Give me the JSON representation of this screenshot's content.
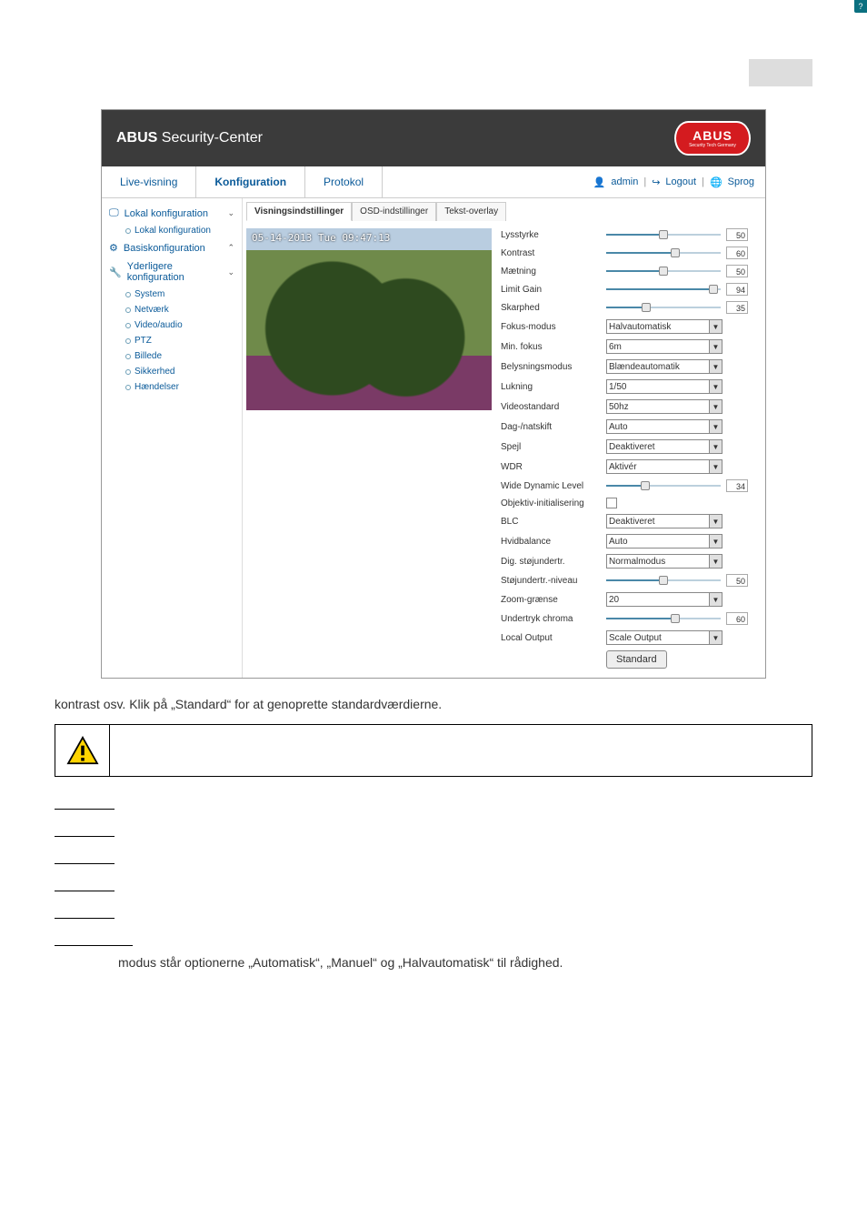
{
  "page_number_box": "",
  "brand_bold": "ABUS",
  "brand_rest": " Security-Center",
  "help_icon": "?",
  "logo_text": "ABUS",
  "logo_sub": "Security Tech Germany",
  "nav": {
    "live": "Live-visning",
    "config": "Konfiguration",
    "protocol": "Protokol"
  },
  "userbar": {
    "user": "admin",
    "logout": "Logout",
    "lang": "Sprog"
  },
  "sidebar": {
    "lokal_hdr": "Lokal konfiguration",
    "lokal_sub": "Lokal konfiguration",
    "basis_hdr": "Basiskonfiguration",
    "yderl_hdr": "Yderligere konfiguration",
    "items": {
      "system": "System",
      "netvaerk": "Netværk",
      "video": "Video/audio",
      "ptz": "PTZ",
      "billede": "Billede",
      "sikkerhed": "Sikkerhed",
      "haendelser": "Hændelser"
    }
  },
  "subtabs": {
    "disp": "Visningsindstillinger",
    "osd": "OSD-indstillinger",
    "text": "Tekst-overlay"
  },
  "preview_osd": "05-14-2013 Tue 09:47:13",
  "settings": {
    "lysstyrke": {
      "label": "Lysstyrke",
      "value": "50"
    },
    "kontrast": {
      "label": "Kontrast",
      "value": "60"
    },
    "maetning": {
      "label": "Mætning",
      "value": "50"
    },
    "limitgain": {
      "label": "Limit Gain",
      "value": "94"
    },
    "skarphed": {
      "label": "Skarphed",
      "value": "35"
    },
    "fokusmodus": {
      "label": "Fokus-modus",
      "value": "Halvautomatisk"
    },
    "minfokus": {
      "label": "Min. fokus",
      "value": "6m"
    },
    "belysning": {
      "label": "Belysningsmodus",
      "value": "Blændeautomatik"
    },
    "lukning": {
      "label": "Lukning",
      "value": "1/50"
    },
    "videostd": {
      "label": "Videostandard",
      "value": "50hz"
    },
    "dagnat": {
      "label": "Dag-/natskift",
      "value": "Auto"
    },
    "spejl": {
      "label": "Spejl",
      "value": "Deaktiveret"
    },
    "wdr": {
      "label": "WDR",
      "value": "Aktivér"
    },
    "wdl": {
      "label": "Wide Dynamic Level",
      "value": "34"
    },
    "objinit": {
      "label": "Objektiv-initialisering"
    },
    "blc": {
      "label": "BLC",
      "value": "Deaktiveret"
    },
    "hvid": {
      "label": "Hvidbalance",
      "value": "Auto"
    },
    "digstoj": {
      "label": "Dig. støjundertr.",
      "value": "Normalmodus"
    },
    "stojniv": {
      "label": "Støjundertr.-niveau",
      "value": "50"
    },
    "zoomg": {
      "label": "Zoom-grænse",
      "value": "20"
    },
    "chroma": {
      "label": "Undertryk chroma",
      "value": "60"
    },
    "localout": {
      "label": "Local Output",
      "value": "Scale Output"
    },
    "standard_btn": "Standard"
  },
  "slider_pct": {
    "lysstyrke": 50,
    "kontrast": 60,
    "maetning": 50,
    "limitgain": 94,
    "skarphed": 35,
    "wdl": 34,
    "stojniv": 50,
    "chroma": 60
  },
  "doc": {
    "para1": "kontrast osv. Klik på „Standard“ for at genoprette standardværdierne.",
    "body_line": "modus står optionerne „Automatisk“, „Manuel“ og „Halvautomatisk“ til rådighed."
  }
}
